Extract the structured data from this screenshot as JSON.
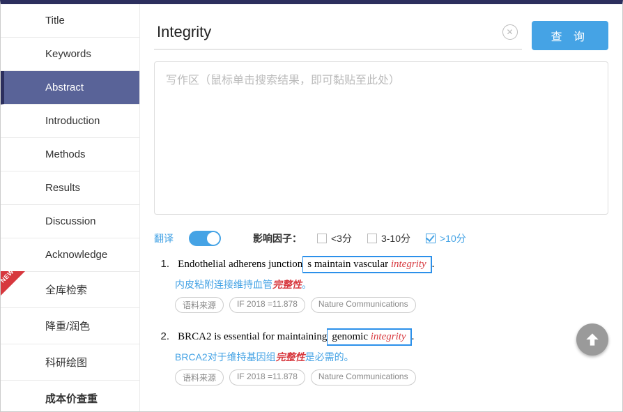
{
  "sidebar": {
    "items": [
      {
        "label": "Title",
        "active": false
      },
      {
        "label": "Keywords",
        "active": false
      },
      {
        "label": "Abstract",
        "active": true
      },
      {
        "label": "Introduction",
        "active": false
      },
      {
        "label": "Methods",
        "active": false
      },
      {
        "label": "Results",
        "active": false
      },
      {
        "label": "Discussion",
        "active": false
      },
      {
        "label": "Acknowledge",
        "active": false
      },
      {
        "label": "全库检索",
        "active": false,
        "new": true
      },
      {
        "label": "降重/润色",
        "active": false
      },
      {
        "label": "科研绘图",
        "active": false
      },
      {
        "label": "成本价查重",
        "active": false,
        "bold": true
      }
    ]
  },
  "search": {
    "value": "Integrity",
    "query_label": "查 询"
  },
  "textarea": {
    "placeholder": "写作区（鼠标单击搜索结果，即可黏贴至此处）",
    "value": ""
  },
  "filters": {
    "translate_label": "翻译",
    "translate_on": true,
    "if_label": "影响因子：",
    "options": [
      {
        "label": "<3分",
        "checked": false
      },
      {
        "label": "3-10分",
        "checked": false
      },
      {
        "label": ">10分",
        "checked": true
      }
    ]
  },
  "results": [
    {
      "num": "1.",
      "en_pre": "Endothelial adherens junction",
      "en_box": "s maintain vascular ",
      "en_kw": "integrity",
      "en_post": ".",
      "zh_pre": "内皮粘附连接维持血管",
      "zh_kw": "完整性",
      "zh_post": "。",
      "tags": [
        "语料来源",
        "IF 2018 =11.878",
        "Nature Communications"
      ]
    },
    {
      "num": "2.",
      "en_pre": "BRCA2 is essential for maintaining",
      "en_box": " genomic ",
      "en_kw": "integrity",
      "en_post": ".",
      "zh_pre": "BRCA2对于维持基因组",
      "zh_kw": "完整性",
      "zh_post": "是必需的。",
      "tags": [
        "语料来源",
        "IF 2018 =11.878",
        "Nature Communications"
      ]
    }
  ]
}
